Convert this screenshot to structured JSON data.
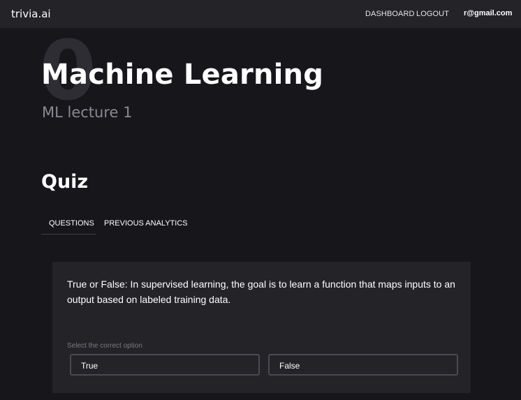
{
  "header": {
    "brand": "trivia.ai",
    "nav": {
      "dashboard": "DASHBOARD",
      "logout": "LOGOUT"
    },
    "user_email": "r@gmail.com"
  },
  "course": {
    "number": "0",
    "title": "Machine Learning",
    "subtitle": "ML lecture 1"
  },
  "quiz": {
    "title": "Quiz",
    "tabs": [
      {
        "label": "QUESTIONS",
        "active": true
      },
      {
        "label": "PREVIOUS ANALYTICS",
        "active": false
      }
    ],
    "question": {
      "text": "True or False: In supervised learning, the goal is to learn a function that maps inputs to an output based on labeled training data.",
      "options_label": "Select the correct option",
      "options": [
        "True",
        "False"
      ]
    }
  },
  "colors": {
    "background": "#17161b",
    "header": "#242328",
    "card": "#242328",
    "muted_text": "#8a898f",
    "option_border": "#4b4a50"
  }
}
